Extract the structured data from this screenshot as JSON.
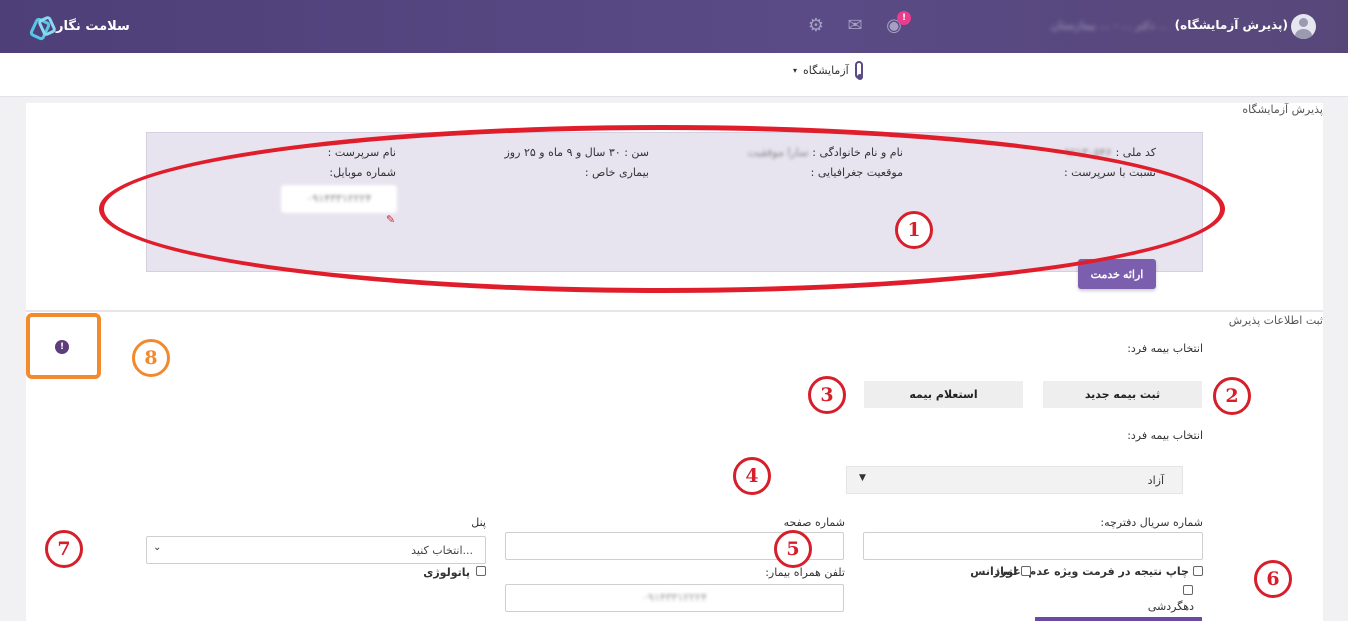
{
  "header": {
    "brand": "سلامت نگار",
    "user_blur": "دکتر ... - ... بیمارستان ...",
    "user_role": "(پذیرش آزمایشگاه)",
    "notification_count": "!"
  },
  "subnav": {
    "label": "آزمایشگاه"
  },
  "reception": {
    "title": "پذیرش آزمایشگاه",
    "national_code_label": "کد ملی :",
    "national_code": "۰۹۲۱۳۰۵۴۶",
    "name_label": "نام و نام خانوادگی :",
    "name": "سارا موفقیت",
    "age": "سن : ۳۰ سال و ۹ ماه و ۲۵ روز",
    "guardian_label": "نام سرپرست :",
    "guardian_relation_label": "نسبت با سرپرست :",
    "geo_label": "موقعیت جغرافیایی :",
    "special_disease_label": "بیماری خاص :",
    "mobile_label": "شماره موبایل:",
    "mobile_value": "۰۹۱۴۳۳۱۲۲۲۴",
    "service_button": "ارائه خدمت"
  },
  "admission": {
    "title": "ثبت اطلاعات پذیرش",
    "insurance_select_label_1": "انتخاب بیمه فرد:",
    "new_insurance_button": "ثبت بیمه جدید",
    "inquiry_button": "استعلام بیمه",
    "insurance_select_label_2": "انتخاب بیمه فرد:",
    "insurance_value": "آزاد",
    "serial_label": "شماره سریال دفترچه:",
    "page_label": "شماره صفحه",
    "panel_label": "پنل",
    "panel_placeholder": "انتخاب کنید...",
    "print_label": "چاپ نتیجه در فرمت ویژه عدم اعتیاد",
    "urgent_label": "اورژانس",
    "pathology_label": "پاتولوژی",
    "companion_phone_label": "تلفن همراه بیمار:",
    "companion_phone_value": "۰۹۱۴۳۳۱۲۲۲۴",
    "hoarding_label": "دهگردشی"
  },
  "annotations": {
    "n1": "1",
    "n2": "2",
    "n3": "3",
    "n4": "4",
    "n5": "5",
    "n6": "6",
    "n7": "7",
    "n8": "8"
  },
  "colors": {
    "topbar": "#4e3f78",
    "accent": "#7b5fae",
    "annotation_red": "#d61f2a",
    "annotation_orange": "#f18a2c"
  }
}
